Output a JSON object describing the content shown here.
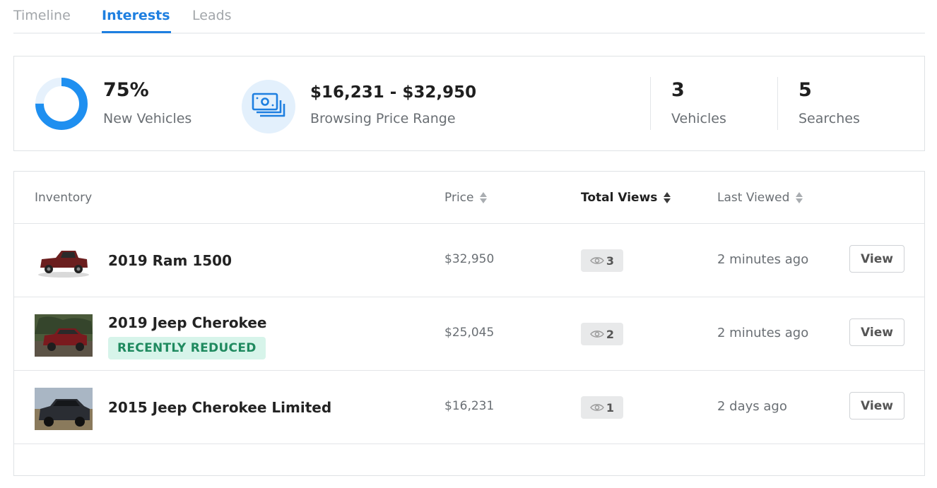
{
  "tabs": [
    {
      "label": "Timeline",
      "active": false
    },
    {
      "label": "Interests",
      "active": true
    },
    {
      "label": "Leads",
      "active": false
    }
  ],
  "summary": {
    "new_vehicles": {
      "value": "75%",
      "label": "New Vehicles",
      "fraction": 0.75
    },
    "price_range": {
      "value": "$16,231 - $32,950",
      "label": "Browsing Price Range",
      "icon": "money-icon"
    },
    "vehicles": {
      "value": "3",
      "label": "Vehicles"
    },
    "searches": {
      "value": "5",
      "label": "Searches"
    }
  },
  "table": {
    "headers": {
      "inventory": "Inventory",
      "price": "Price",
      "total_views": "Total Views",
      "last_viewed": "Last Viewed"
    },
    "sorted_column": "total_views",
    "rows": [
      {
        "name": "2019 Ram 1500",
        "badge": "",
        "price": "$32,950",
        "views": "3",
        "last_viewed": "2 minutes ago",
        "action": "View",
        "thumb_color": "#6b1e1e"
      },
      {
        "name": "2019 Jeep Cherokee",
        "badge": "RECENTLY REDUCED",
        "price": "$25,045",
        "views": "2",
        "last_viewed": "2 minutes ago",
        "action": "View",
        "thumb_color": "#7a1a1e"
      },
      {
        "name": "2015 Jeep Cherokee Limited",
        "badge": "",
        "price": "$16,231",
        "views": "1",
        "last_viewed": "2 days ago",
        "action": "View",
        "thumb_color": "#2a2d33"
      }
    ]
  },
  "colors": {
    "accent": "#1e7fe0",
    "badge_bg": "#d7f4ea",
    "badge_text": "#1f8a5f"
  }
}
